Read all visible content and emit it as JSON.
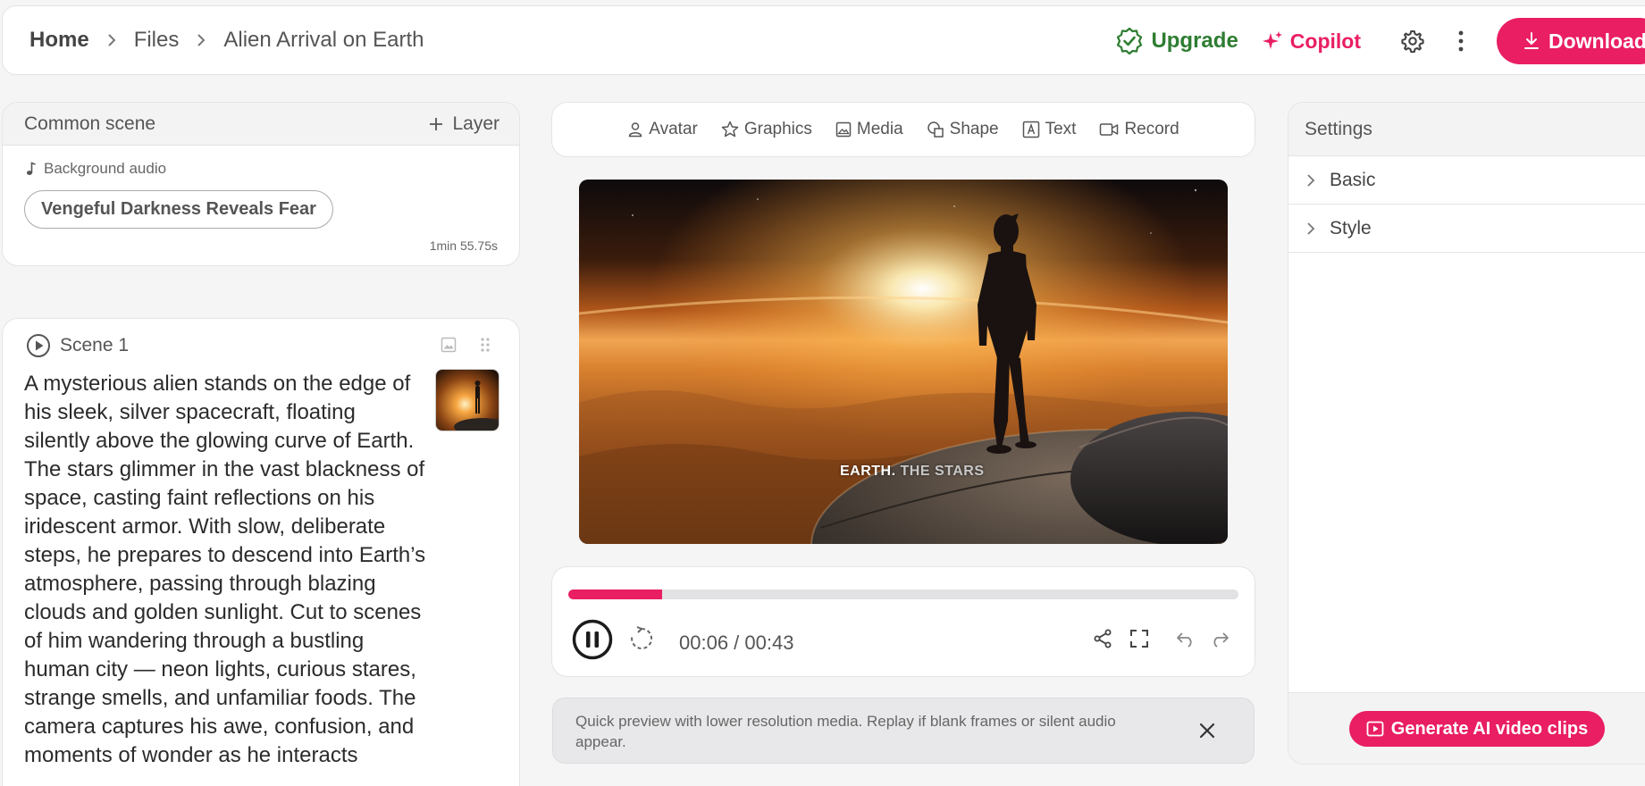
{
  "breadcrumb": {
    "home": "Home",
    "files": "Files",
    "current": "Alien Arrival on Earth"
  },
  "header": {
    "upgrade_label": "Upgrade",
    "copilot_label": "Copilot",
    "download_label": "Download"
  },
  "common_scene": {
    "title": "Common scene",
    "layer_label": "Layer",
    "bg_audio_label": "Background audio",
    "audio_track": "Vengeful Darkness Reveals Fear",
    "duration": "1min 55.75s"
  },
  "scene": {
    "title": "Scene 1",
    "script": "A mysterious alien stands on the edge of his sleek, silver spacecraft, floating silently above the glowing curve of Earth. The stars glimmer in the vast blackness of space, casting faint reflections on his iridescent armor. With slow, deliberate steps, he prepares to descend into Earth’s atmosphere, passing through blazing clouds and golden sunlight. Cut to scenes of him wandering through a bustling human city — neon lights, curious stares, strange smells, and unfamiliar foods. The camera captures his awe, confusion, and moments of wonder as he interacts"
  },
  "toolbar": {
    "avatar": "Avatar",
    "graphics": "Graphics",
    "media": "Media",
    "shape": "Shape",
    "text": "Text",
    "record": "Record"
  },
  "preview": {
    "caption_main": "EARTH.",
    "caption_sub": "THE STARS"
  },
  "player": {
    "timecode": "00:06 / 00:43",
    "progress": 0.14
  },
  "notice": {
    "text": "Quick preview with lower resolution media. Replay if blank frames or silent audio appear."
  },
  "settings": {
    "title": "Settings",
    "basic": "Basic",
    "style": "Style",
    "generate_label": "Generate AI video clips"
  },
  "colors": {
    "accent": "#e91e63",
    "upgrade": "#2e7d32"
  },
  "icons": {
    "upgrade": "verified-badge-icon",
    "copilot": "sparkle-icon",
    "settings": "gear-icon",
    "more": "kebab-icon",
    "download": "download-icon"
  }
}
